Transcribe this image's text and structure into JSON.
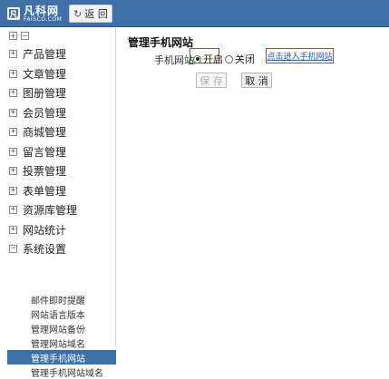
{
  "header": {
    "logo_text": "凡科网",
    "logo_sub": "FAISCO.COM",
    "back_label": "返 回",
    "back_icon": "refresh-icon"
  },
  "sidebar": {
    "menu": [
      {
        "label": "产品管理",
        "expander": "+"
      },
      {
        "label": "文章管理",
        "expander": "+"
      },
      {
        "label": "图册管理",
        "expander": "+"
      },
      {
        "label": "会员管理",
        "expander": "+"
      },
      {
        "label": "商城管理",
        "expander": "+"
      },
      {
        "label": "留言管理",
        "expander": "+"
      },
      {
        "label": "投票管理",
        "expander": "+"
      },
      {
        "label": "表单管理",
        "expander": "+"
      },
      {
        "label": "资源库管理",
        "expander": "+"
      },
      {
        "label": "网站统计",
        "expander": "+"
      },
      {
        "label": "系统设置",
        "expander": "−"
      }
    ],
    "submenu": [
      {
        "label": "邮件即时提醒",
        "active": false
      },
      {
        "label": "网站语言版本",
        "active": false
      },
      {
        "label": "管理网站备份",
        "active": false
      },
      {
        "label": "管理网站域名",
        "active": false
      },
      {
        "label": "管理手机网站",
        "active": true
      },
      {
        "label": "管理手机网站域名",
        "active": false
      }
    ]
  },
  "main": {
    "title": "管理手机网站",
    "field_label": "手机网站:",
    "option_on": "开启",
    "option_off": "关闭",
    "selected": "开启",
    "link_text": "点击进入手机网站",
    "save_label": "保 存",
    "cancel_label": "取 消"
  },
  "colors": {
    "topbar": "#3e6fa6",
    "highlight_border": "#e03030",
    "active_item": "#3e6fa6",
    "link": "#2a55a8"
  }
}
